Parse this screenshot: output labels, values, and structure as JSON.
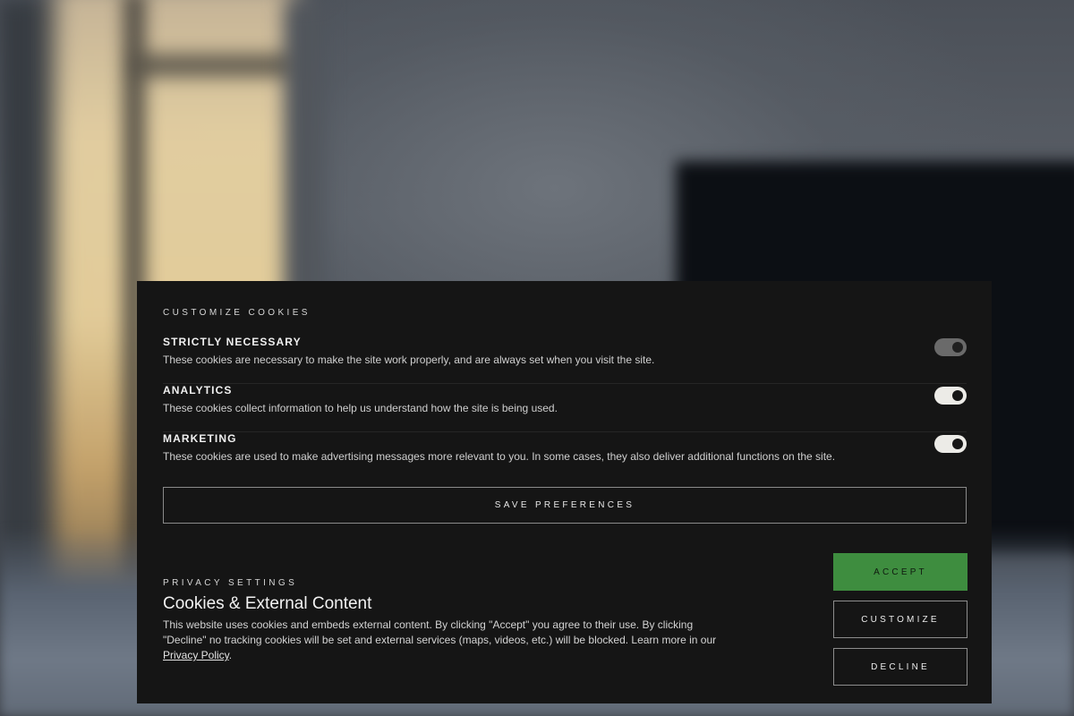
{
  "customize": {
    "heading": "CUSTOMIZE COOKIES",
    "categories": [
      {
        "name": "STRICTLY NECESSARY",
        "description": "These cookies are necessary to make the site work properly, and are always set when you visit the site.",
        "enabled": true,
        "locked": true
      },
      {
        "name": "ANALYTICS",
        "description": "These cookies collect information to help us understand how the site is being used.",
        "enabled": true,
        "locked": false
      },
      {
        "name": "MARKETING",
        "description": "These cookies are used to make advertising messages more relevant to you. In some cases, they also deliver additional functions on the site.",
        "enabled": true,
        "locked": false
      }
    ],
    "save_label": "SAVE PREFERENCES"
  },
  "privacy": {
    "heading": "PRIVACY SETTINGS",
    "title": "Cookies & External Content",
    "body_text": "This website uses cookies and embeds external content. By clicking \"Accept\" you agree to their use. By clicking \"Decline\" no tracking cookies will be set and external services (maps, videos, etc.) will be blocked. Learn more in our",
    "link_label": "Privacy Policy",
    "body_end": "."
  },
  "actions": {
    "accept_label": "ACCEPT",
    "customize_label": "CUSTOMIZE",
    "decline_label": "DECLINE"
  },
  "colors": {
    "accept": "#3e8d3f",
    "panel": "#151515"
  }
}
